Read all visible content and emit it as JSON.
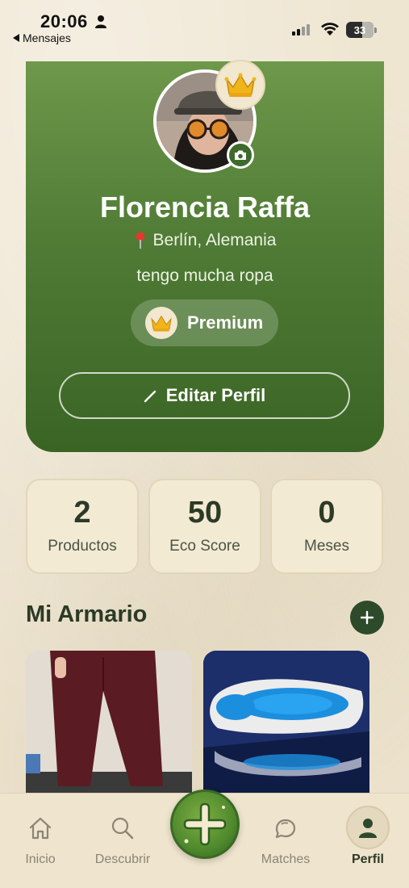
{
  "status_bar": {
    "time": "20:06",
    "back_label": "Mensajes",
    "battery": "33"
  },
  "profile": {
    "name": "Florencia Raffa",
    "location": "Berlín, Alemania",
    "bio": "tengo mucha ropa",
    "badge": "Premium",
    "edit_label": "Editar Perfil"
  },
  "stats": [
    {
      "value": "2",
      "label": "Productos"
    },
    {
      "value": "50",
      "label": "Eco Score"
    },
    {
      "value": "0",
      "label": "Meses"
    }
  ],
  "wardrobe": {
    "title": "Mi Armario",
    "items": [
      "pants-photo",
      "sneaker-photo"
    ]
  },
  "nav": {
    "items": [
      {
        "label": "Inicio",
        "icon": "home-icon"
      },
      {
        "label": "Descubrir",
        "icon": "search-icon"
      },
      {
        "label": "Matches",
        "icon": "chat-icon"
      },
      {
        "label": "Perfil",
        "icon": "person-icon",
        "active": true
      }
    ]
  },
  "colors": {
    "accent_green": "#507c36",
    "dark_green": "#2d4a2a",
    "background": "#efe6d2"
  }
}
